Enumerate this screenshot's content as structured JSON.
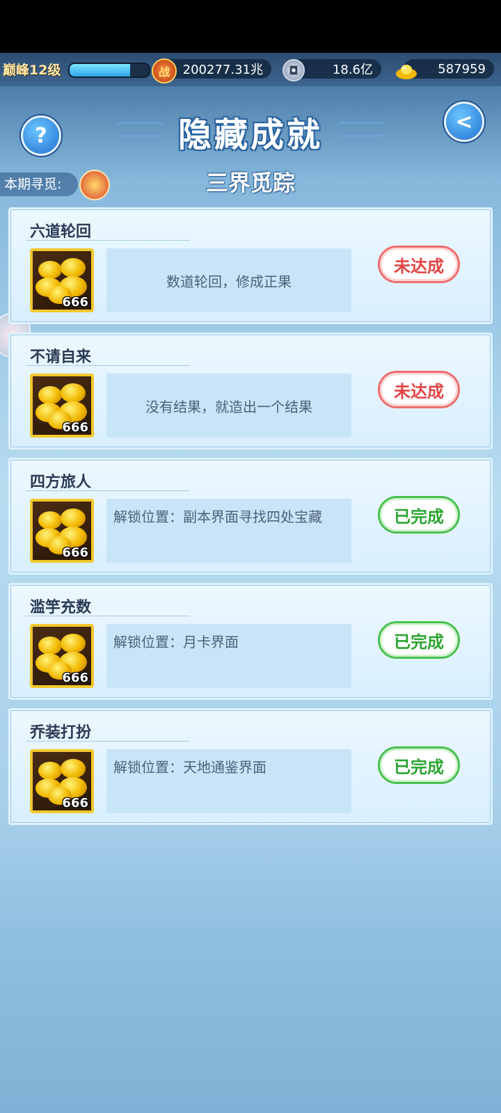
{
  "header": {
    "level_label": "巅峰12级",
    "exp_progress": 0.76,
    "power_icon": "fight-icon",
    "power_value": "200277.31兆",
    "coin_icon": "copper-coin-icon",
    "coin_value": "18.6亿",
    "gold_icon": "gold-ingot-icon",
    "gold_value": "587959"
  },
  "title": "隐藏成就",
  "help_label": "?",
  "back_label": "<",
  "period": {
    "label": "本期寻觅:",
    "subtitle": "三界觅踪"
  },
  "achievements": [
    {
      "name": "六道轮回",
      "reward_qty": "666",
      "desc": "数道轮回，修成正果",
      "status": "未达成",
      "done": false
    },
    {
      "name": "不请自来",
      "reward_qty": "666",
      "desc": "没有结果，就造出一个结果",
      "status": "未达成",
      "done": false
    },
    {
      "name": "四方旅人",
      "reward_qty": "666",
      "desc": "解锁位置：副本界面寻找四处宝藏",
      "status": "已完成",
      "done": true
    },
    {
      "name": "滥竽充数",
      "reward_qty": "666",
      "desc": "解锁位置：月卡界面",
      "status": "已完成",
      "done": true
    },
    {
      "name": "乔装打扮",
      "reward_qty": "666",
      "desc": "解锁位置：天地通鉴界面",
      "status": "已完成",
      "done": true
    }
  ],
  "colors": {
    "pending": "#e24444",
    "done": "#2ca431",
    "card_bg": "#e4f4ff"
  }
}
